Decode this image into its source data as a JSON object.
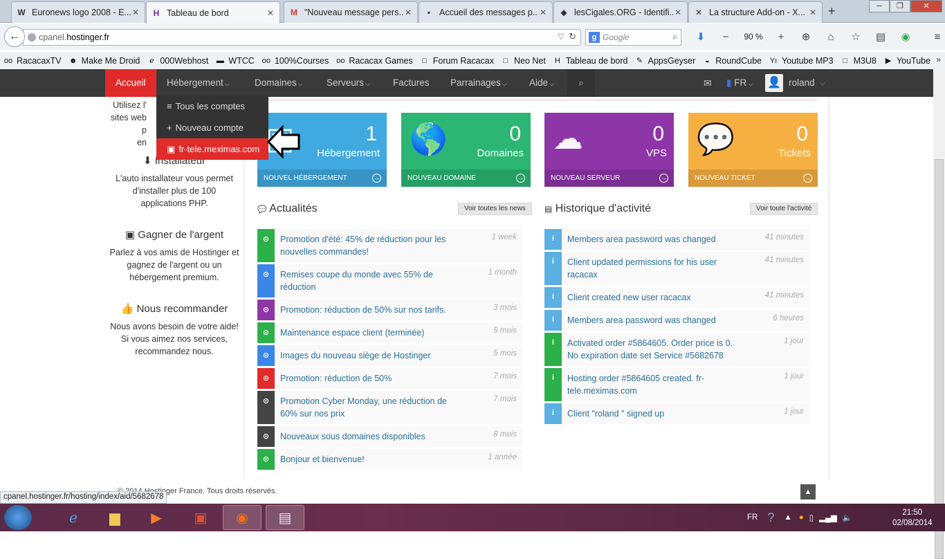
{
  "browser": {
    "tabs": [
      {
        "label": "Euronews logo 2008 - E...",
        "icon": "W",
        "active": false
      },
      {
        "label": "Tableau de bord",
        "icon": "H",
        "active": true
      },
      {
        "label": "\"Nouveau message pers...",
        "icon": "M",
        "active": false
      },
      {
        "label": "Accueil des messages p...",
        "icon": "▪",
        "active": false
      },
      {
        "label": "lesCigales.ORG - Identifi...",
        "icon": "◆",
        "active": false
      },
      {
        "label": "La structure Add-on - X...",
        "icon": "✕",
        "active": false
      }
    ],
    "new_tab": "+",
    "url_prefix": "cpanel.",
    "url_domain": "hostinger.fr",
    "search_placeholder": "Google",
    "search_engine_letter": "g",
    "zoom": "90 %",
    "window_buttons": {
      "minimize": "─",
      "restore": "❐",
      "close": "✕"
    }
  },
  "bookmarks": [
    {
      "label": "RacacaxTV",
      "icon": "oo"
    },
    {
      "label": "Make Me Droid",
      "icon": "☻"
    },
    {
      "label": "000Webhost",
      "icon": "ℯ"
    },
    {
      "label": "WTCC",
      "icon": "▬"
    },
    {
      "label": "100%Courses",
      "icon": "oo"
    },
    {
      "label": "Racacax Games",
      "icon": "oo"
    },
    {
      "label": "Forum Racacax",
      "icon": "□"
    },
    {
      "label": "Neo Net",
      "icon": "□"
    },
    {
      "label": "Tableau de bord",
      "icon": "H"
    },
    {
      "label": "AppsGeyser",
      "icon": "✎"
    },
    {
      "label": "RoundCube",
      "icon": "◒"
    },
    {
      "label": "Youtube MP3",
      "icon": "Yı"
    },
    {
      "label": "M3U8",
      "icon": "□"
    },
    {
      "label": "YouTube",
      "icon": "▶"
    }
  ],
  "bookmarks_more": "»",
  "nav": {
    "accueil": "Accueil",
    "hebergement": "Hébergement",
    "domaines": "Domaines",
    "serveurs": "Serveurs",
    "factures": "Factures",
    "parrainages": "Parrainages",
    "aide": "Aide",
    "lang": "FR",
    "user": "roland"
  },
  "dropdown": [
    {
      "label": "Tous les comptes",
      "icon": "≡"
    },
    {
      "label": "Nouveau compte",
      "icon": "+"
    },
    {
      "label": "fr-tele.meximas.com",
      "icon": "▣"
    }
  ],
  "sidebar": {
    "intro_1": "Utilisez l'",
    "intro_2": "sites web p",
    "intro_3": "en",
    "installer_title": "Installateur",
    "installer_text": "L'auto installateur vous permet d'installer plus de 100 applications PHP.",
    "earn_title": "Gagner de l'argent",
    "earn_text": "Parlez à vos amis de Hostinger et gagnez de l'argent ou un hébergement premium.",
    "recommend_title": "Nous recommander",
    "recommend_text": "Nous avons besoin de votre aide! Si vous aimez nos services, recommandez nous."
  },
  "tiles": [
    {
      "count": "1",
      "label": "Hébergement",
      "footer": "Nouvel hébergement",
      "color": "#3fa9e0"
    },
    {
      "count": "0",
      "label": "Domaines",
      "footer": "Nouveau domaine",
      "color": "#2bb673"
    },
    {
      "count": "0",
      "label": "VPS",
      "footer": "Nouveau serveur",
      "color": "#8e36a8"
    },
    {
      "count": "0",
      "label": "Tickets",
      "footer": "Nouveau ticket",
      "color": "#f6b042"
    }
  ],
  "news": {
    "title": "Actualités",
    "button": "Voir toutes les news",
    "items": [
      {
        "text": "Promotion d'été: 45% de réduction pour les nouvelles commandes!",
        "time": "1 week",
        "color": "#2bb04a"
      },
      {
        "text": "Remises coupe du monde avec 55% de réduction",
        "time": "1 month",
        "color": "#3b86e8"
      },
      {
        "text": "Promotion: réduction de 50% sur nos tarifs.",
        "time": "3 mois",
        "color": "#8e36a8"
      },
      {
        "text": "Maintenance espace client (terminée)",
        "time": "5 mois",
        "color": "#2bb04a"
      },
      {
        "text": "Images du nouveau siège de Hostinger",
        "time": "5 mois",
        "color": "#3b86e8"
      },
      {
        "text": "Promotion: réduction de 50%",
        "time": "7 mois",
        "color": "#e12b2b"
      },
      {
        "text": "Promotion Cyber Monday, une réduction de 60% sur nos prix",
        "time": "7 mois",
        "color": "#444444"
      },
      {
        "text": "Nouveaux sous domaines disponibles",
        "time": "8 mois",
        "color": "#444444"
      },
      {
        "text": "Bonjour et bienvenue!",
        "time": "1 année",
        "color": "#2bb04a"
      }
    ]
  },
  "activity": {
    "title": "Historique d'activité",
    "button": "Voir toute l'activité",
    "items": [
      {
        "text": "Members area password was changed",
        "time": "41 minutes",
        "color": "#5ab0e0"
      },
      {
        "text": "Client updated permissions for his user racacax",
        "time": "41 minutes",
        "color": "#5ab0e0"
      },
      {
        "text": "Client created new user racacax",
        "time": "41 minutes",
        "color": "#5ab0e0"
      },
      {
        "text": "Members area password was changed",
        "time": "6 heures",
        "color": "#5ab0e0"
      },
      {
        "text": "Activated order #5864605. Order price is 0. No expiration date set Service #5682678",
        "time": "1 jour",
        "color": "#2bb04a"
      },
      {
        "text": "Hosting order #5864605 created. fr-tele.meximas.com",
        "time": "1 jour",
        "color": "#2bb04a"
      },
      {
        "text": "Client \"roland \" signed up",
        "time": "1 jour",
        "color": "#5ab0e0"
      }
    ]
  },
  "footer": {
    "copyright": "© 2014 Hostinger France. Tous droits réservés."
  },
  "status_url": "cpanel.hostinger.fr/hosting/index/aid/5682678",
  "taskbar": {
    "lang": "FR",
    "time": "21:50",
    "date": "02/08/2014"
  }
}
